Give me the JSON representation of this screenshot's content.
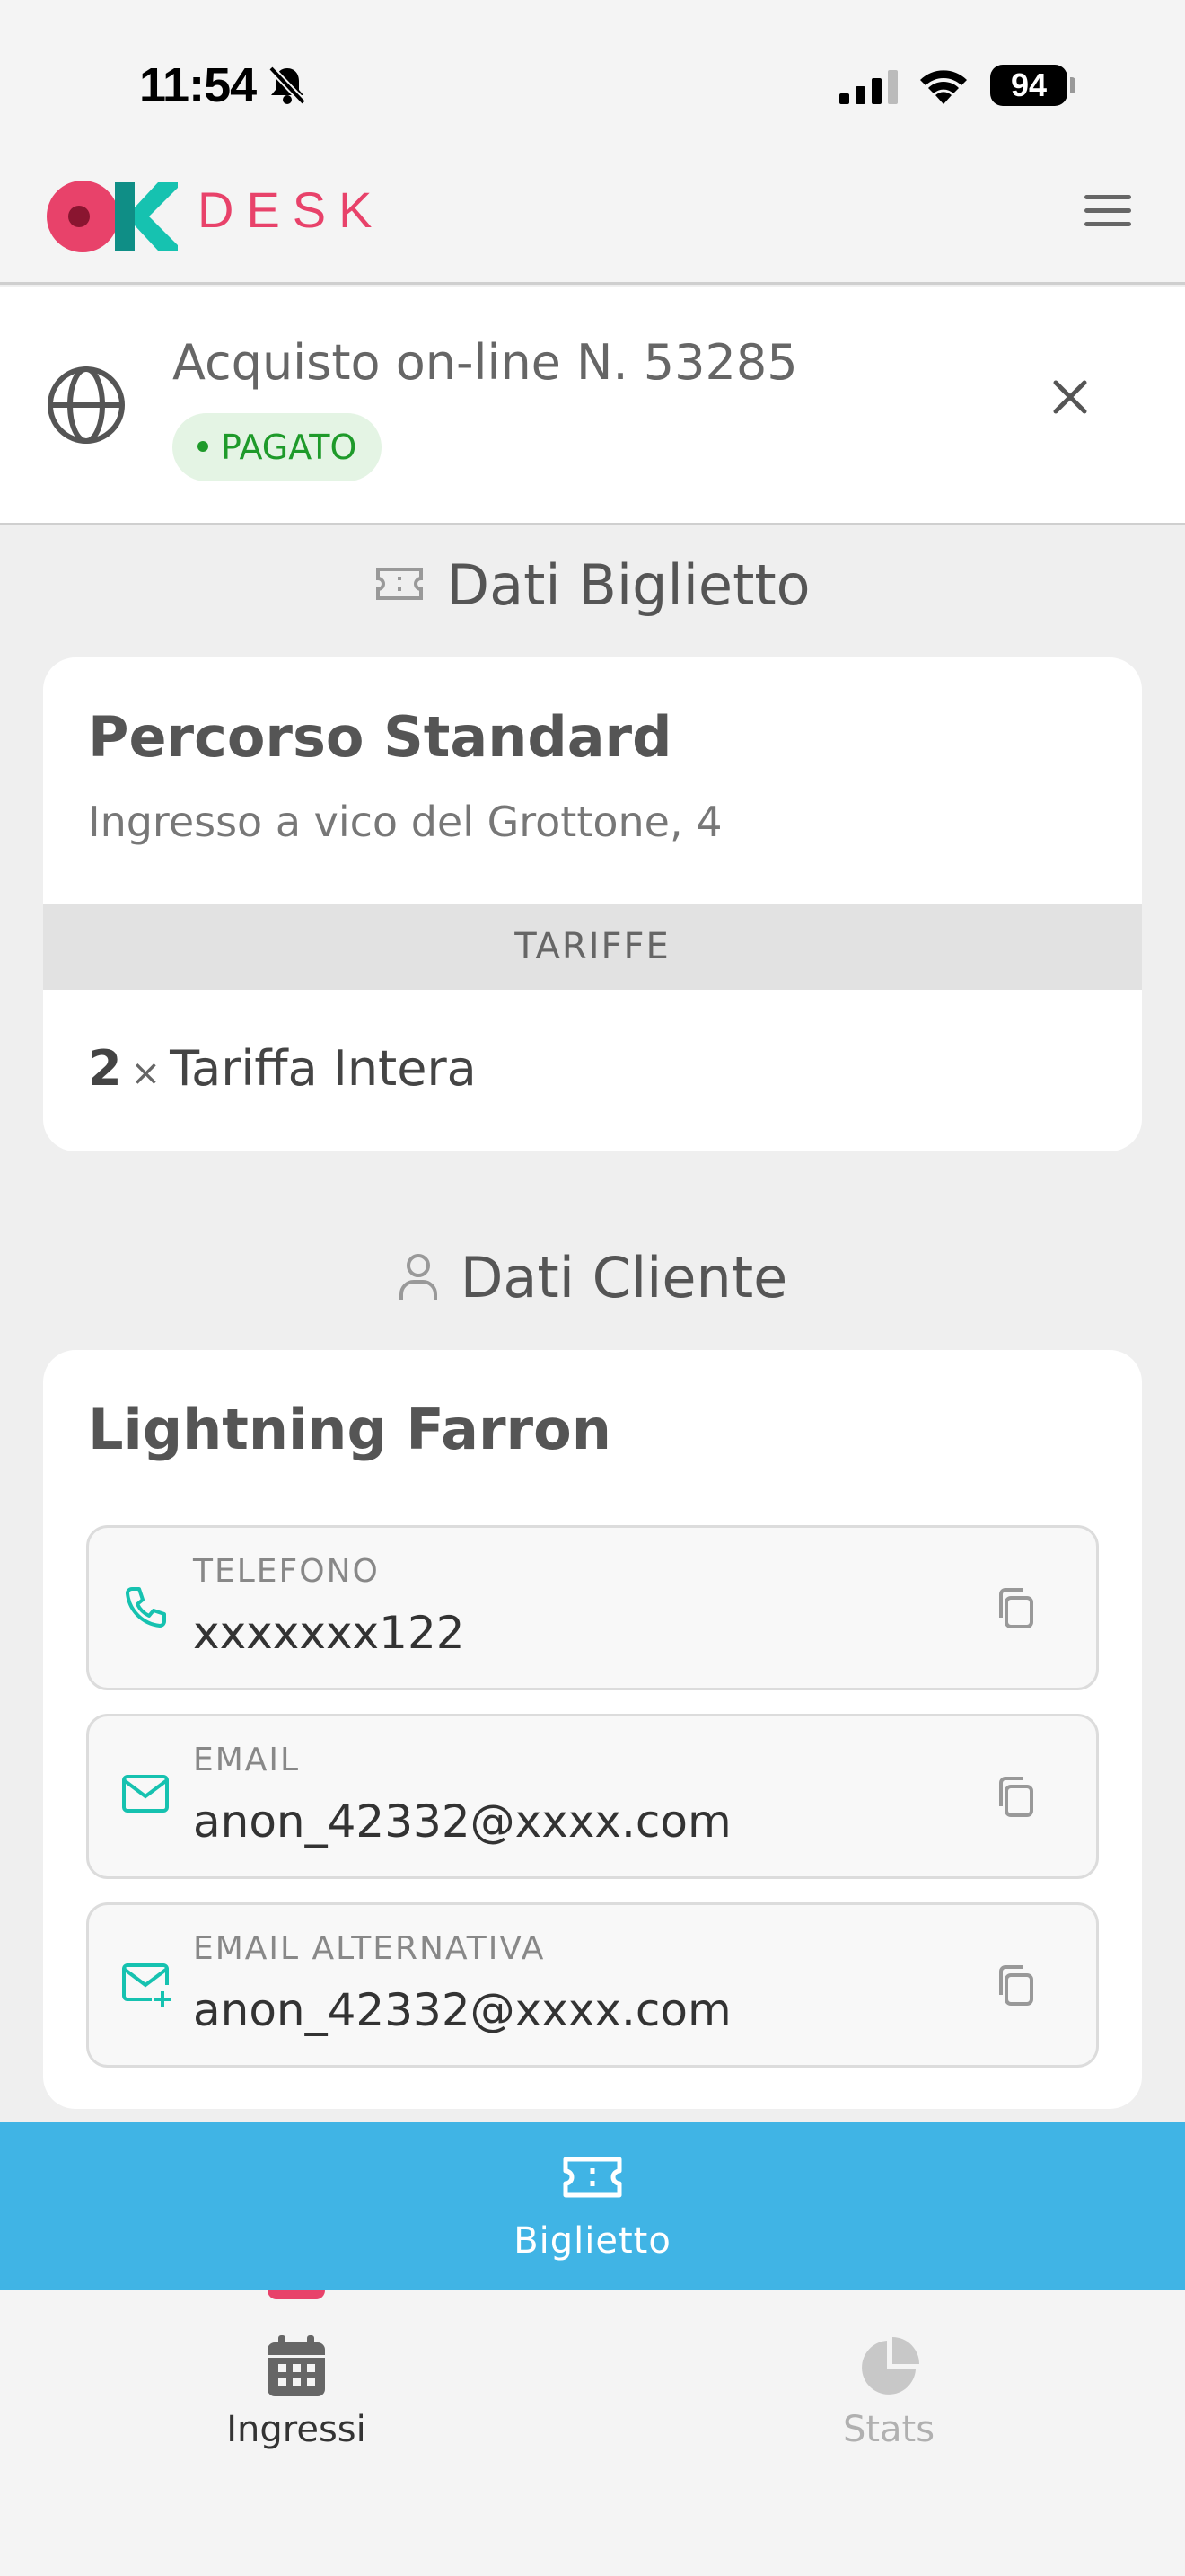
{
  "status_bar": {
    "time": "11:54",
    "battery": "94"
  },
  "app_bar": {
    "logo_text": "DESK"
  },
  "order": {
    "title": "Acquisto on-line N. 53285",
    "status": "PAGATO"
  },
  "ticket_section": {
    "heading": "Dati Biglietto",
    "route_name": "Percorso Standard",
    "route_entrance": "Ingresso a vico del Grottone, 4",
    "tariffs_header": "TARIFFE",
    "tariffs": [
      {
        "qty": "2",
        "times": "×",
        "name": "Tariffa Intera"
      }
    ]
  },
  "customer_section": {
    "heading": "Dati Cliente",
    "name": "Lightning Farron",
    "fields": [
      {
        "label": "TELEFONO",
        "value": "xxxxxxx122",
        "icon": "phone-icon"
      },
      {
        "label": "EMAIL",
        "value": "anon_42332@xxxx.com",
        "icon": "mail-icon"
      },
      {
        "label": "EMAIL ALTERNATIVA",
        "value": "anon_42332@xxxx.com",
        "icon": "mail-plus-icon"
      }
    ]
  },
  "action_bar": {
    "label": "Biglietto"
  },
  "tab_bar": {
    "tabs": [
      {
        "label": "Ingressi",
        "active": true
      },
      {
        "label": "Stats",
        "active": false
      }
    ]
  },
  "colors": {
    "brand_pink": "#e8426a",
    "brand_teal": "#16c2b0",
    "action_blue": "#40b4e5",
    "paid_green": "#1e9a2a"
  }
}
